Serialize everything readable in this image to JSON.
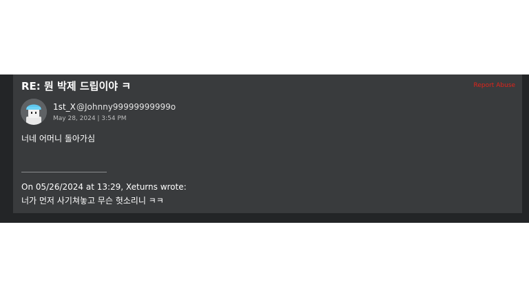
{
  "post": {
    "title": "RE: 뭔 박제 드립이야 ㅋ",
    "report_label": "Report Abuse",
    "author": {
      "username": "1st_X",
      "handle": "@Johnny99999999999o",
      "avatar_icon": "roblox-avatar-icon"
    },
    "date": "May 28, 2024 | 3:54 PM",
    "body": "너네 어머니 돌아가심",
    "quote": {
      "divider": "----------------------------------",
      "header": "On 05/26/2024 at 13:29, Xeturns wrote:",
      "text": "너가 먼저 사기쳐놓고 무슨 헛소리니 ㅋㅋ"
    }
  },
  "colors": {
    "page_background": "#ffffff",
    "outer_band": "#232527",
    "card_background": "#393b3d",
    "report_link": "#e2231a",
    "text_primary": "#ffffff",
    "text_secondary": "#bdbebe"
  }
}
